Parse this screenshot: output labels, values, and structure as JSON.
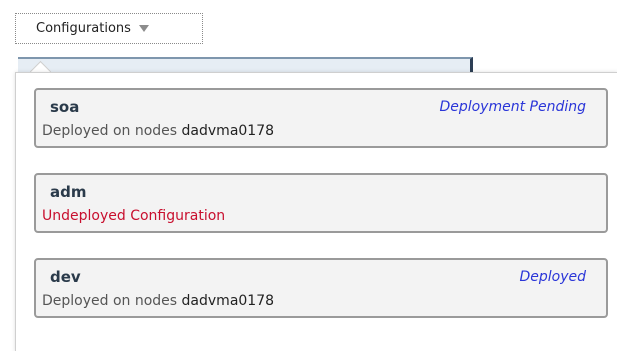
{
  "dropdown": {
    "label": "Configurations"
  },
  "configurations": [
    {
      "name": "soa",
      "status": "Deployment Pending",
      "detail_prefix": "Deployed on nodes",
      "node": "dadvma0178"
    },
    {
      "name": "adm",
      "status": "",
      "detail_text": "Undeployed Configuration"
    },
    {
      "name": "dev",
      "status": "Deployed",
      "detail_prefix": "Deployed on nodes",
      "node": "dadvma0178"
    }
  ],
  "colors": {
    "status_blue": "#2a35d8",
    "warning_red": "#c80f2e",
    "card_border": "#9a9a9a",
    "card_bg": "#f3f3f3"
  }
}
